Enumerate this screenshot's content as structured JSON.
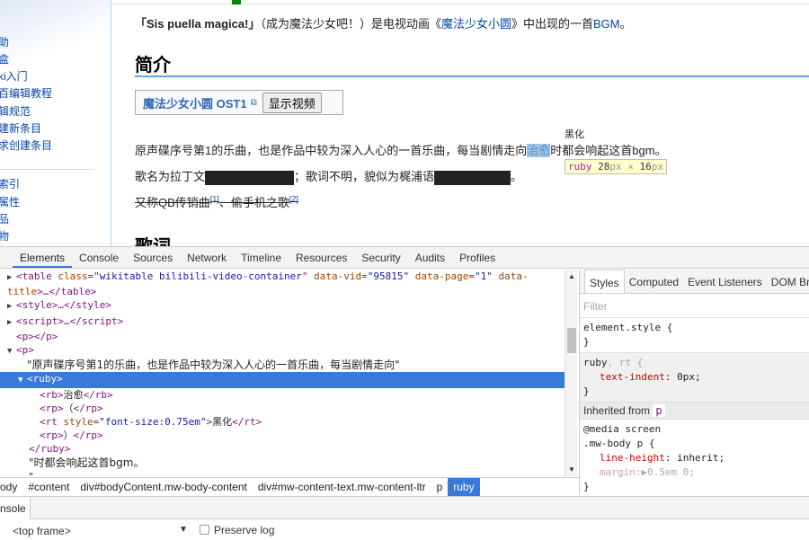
{
  "sidebar": {
    "items": [
      "助",
      "盒",
      "ki入门",
      "百编辑教程",
      "辑规范",
      "建新条目",
      "求创建条目",
      "索引",
      "属性",
      "品",
      "物"
    ]
  },
  "article": {
    "intro": {
      "bold": "「Sis puella magica!」",
      "mid": "（成为魔法少女吧！）是电视动画《",
      "link": "魔法少女小圆",
      "mid2": "》中出现的一首",
      "bgm": "BGM",
      "end": "。"
    },
    "heading1": "简介",
    "video": {
      "title": "魔法少女小圆 OST1",
      "button": "显示视频"
    },
    "p1": {
      "before": "原声碟序号第1的乐曲，也是作品中较为深入人心的一首乐曲，每当剧情走向",
      "rb": "治愈",
      "rt": "黑化",
      "after": "时都会响起这首bgm。"
    },
    "p2": {
      "a": "歌名为拉丁文",
      "b": "；歌词不明，貌似为梶浦语",
      "c": "。"
    },
    "p3": {
      "a": "又称QB传销曲",
      "ref1": "[1]",
      "b": "、偷手机之歌",
      "ref2": "[2]"
    },
    "heading2": "歌词",
    "tooltip": {
      "tag": "ruby",
      "w": "28",
      "h": "16",
      "unit": "px",
      "x": "×"
    }
  },
  "devtools": {
    "tabs": [
      "Elements",
      "Console",
      "Sources",
      "Network",
      "Timeline",
      "Resources",
      "Security",
      "Audits",
      "Profiles"
    ],
    "dom": {
      "l1a": "<table ",
      "l1b": "class",
      "l1c": "=\"",
      "l1d": "wikitable bilibili-video-container",
      "l1e": "\" ",
      "l1f": "data-vid",
      "l1g": "\"95815\"",
      "l1h": " data-page",
      "l1i": "\"1\"",
      "l1j": " data-",
      "l2a": "title",
      "l2b": ">…</table>",
      "l3": "<style>…</style>",
      "l4": "<script>…</script>",
      "l5": "<p></p>",
      "l6": "<p>",
      "l7": "\"原声碟序号第1的乐曲，也是作品中较为深入人心的一首乐曲，每当剧情走向\"",
      "l8": "<ruby>",
      "l9a": "<rb>",
      "l9b": "治愈",
      "l9c": "</rb>",
      "l10a": "<rp>",
      "l10b": "（",
      "l10c": "</rp>",
      "l11a": "<rt ",
      "l11b": "style",
      "l11c": "\"font-size:0.75em\"",
      "l11d": ">",
      "l11e": "黑化",
      "l11f": "</rt>",
      "l12a": "<rp>",
      "l12b": "）",
      "l12c": "</rp>",
      "l13": "</ruby>",
      "l14": "\"时都会响起这首bgm。",
      "l15": "\""
    },
    "breadcrumbs": [
      "ody",
      "#content",
      "div#bodyContent.mw-body-content",
      "div#mw-content-text.mw-content-ltr",
      "p",
      "ruby"
    ],
    "side_tabs": [
      "Styles",
      "Computed",
      "Event Listeners",
      "DOM Br"
    ],
    "filter": "Filter",
    "styles": {
      "r1": "element.style {",
      "close": "}",
      "r2sel": "ruby",
      "r2sel2": ", rt {",
      "r2p": "text-indent",
      "r2v": ": 0px;",
      "inherited": "Inherited from",
      "inh_tag": "p",
      "r3media": "@media screen",
      "r3sel": ".mw-body p {",
      "r3p": "line-height",
      "r3v": ": inherit;",
      "r3p2": "margin:",
      "r3v2": "▶0.5em 0;"
    },
    "drawer_tab": "nsole",
    "console": {
      "frame": "<top frame>",
      "preserve": "Preserve log"
    }
  }
}
